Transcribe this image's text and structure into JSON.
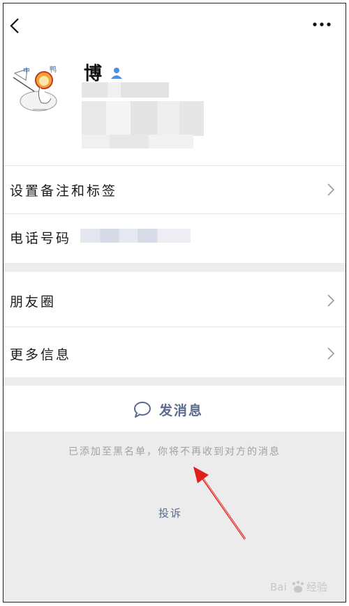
{
  "profile": {
    "name": "博"
  },
  "rows": {
    "remark_tags": "设置备注和标签",
    "phone": "电话号码",
    "moments": "朋友圈",
    "more_info": "更多信息"
  },
  "actions": {
    "send_message": "发消息"
  },
  "blocked_notice": "已添加至黑名单，你将不再收到对方的消息",
  "complain": "投诉",
  "watermark": {
    "text": "Baidu经验"
  },
  "colors": {
    "link": "#5a6b8c",
    "annotation_arrow": "#e0201b",
    "verified": "#4a8fe0"
  }
}
